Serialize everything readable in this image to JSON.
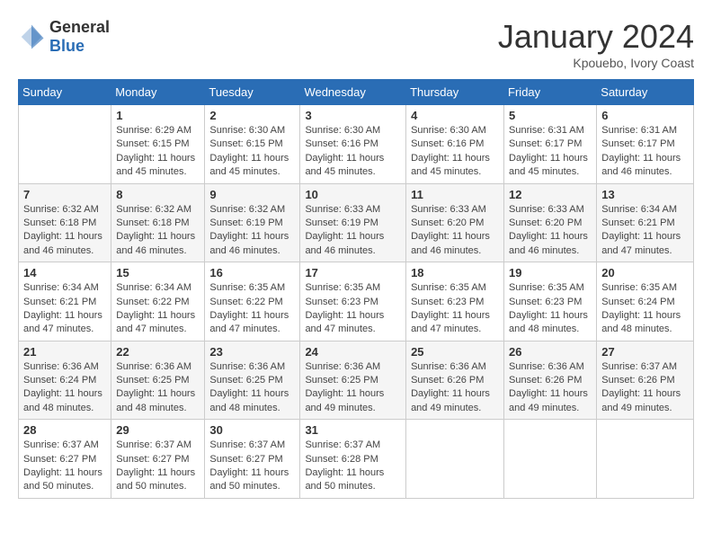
{
  "logo": {
    "general": "General",
    "blue": "Blue"
  },
  "title": "January 2024",
  "subtitle": "Kpouebo, Ivory Coast",
  "days": [
    "Sunday",
    "Monday",
    "Tuesday",
    "Wednesday",
    "Thursday",
    "Friday",
    "Saturday"
  ],
  "weeks": [
    [
      {
        "day": "",
        "content": ""
      },
      {
        "day": "1",
        "content": "Sunrise: 6:29 AM\nSunset: 6:15 PM\nDaylight: 11 hours and 45 minutes."
      },
      {
        "day": "2",
        "content": "Sunrise: 6:30 AM\nSunset: 6:15 PM\nDaylight: 11 hours and 45 minutes."
      },
      {
        "day": "3",
        "content": "Sunrise: 6:30 AM\nSunset: 6:16 PM\nDaylight: 11 hours and 45 minutes."
      },
      {
        "day": "4",
        "content": "Sunrise: 6:30 AM\nSunset: 6:16 PM\nDaylight: 11 hours and 45 minutes."
      },
      {
        "day": "5",
        "content": "Sunrise: 6:31 AM\nSunset: 6:17 PM\nDaylight: 11 hours and 45 minutes."
      },
      {
        "day": "6",
        "content": "Sunrise: 6:31 AM\nSunset: 6:17 PM\nDaylight: 11 hours and 46 minutes."
      }
    ],
    [
      {
        "day": "7",
        "content": "Sunrise: 6:32 AM\nSunset: 6:18 PM\nDaylight: 11 hours and 46 minutes."
      },
      {
        "day": "8",
        "content": "Sunrise: 6:32 AM\nSunset: 6:18 PM\nDaylight: 11 hours and 46 minutes."
      },
      {
        "day": "9",
        "content": "Sunrise: 6:32 AM\nSunset: 6:19 PM\nDaylight: 11 hours and 46 minutes."
      },
      {
        "day": "10",
        "content": "Sunrise: 6:33 AM\nSunset: 6:19 PM\nDaylight: 11 hours and 46 minutes."
      },
      {
        "day": "11",
        "content": "Sunrise: 6:33 AM\nSunset: 6:20 PM\nDaylight: 11 hours and 46 minutes."
      },
      {
        "day": "12",
        "content": "Sunrise: 6:33 AM\nSunset: 6:20 PM\nDaylight: 11 hours and 46 minutes."
      },
      {
        "day": "13",
        "content": "Sunrise: 6:34 AM\nSunset: 6:21 PM\nDaylight: 11 hours and 47 minutes."
      }
    ],
    [
      {
        "day": "14",
        "content": "Sunrise: 6:34 AM\nSunset: 6:21 PM\nDaylight: 11 hours and 47 minutes."
      },
      {
        "day": "15",
        "content": "Sunrise: 6:34 AM\nSunset: 6:22 PM\nDaylight: 11 hours and 47 minutes."
      },
      {
        "day": "16",
        "content": "Sunrise: 6:35 AM\nSunset: 6:22 PM\nDaylight: 11 hours and 47 minutes."
      },
      {
        "day": "17",
        "content": "Sunrise: 6:35 AM\nSunset: 6:23 PM\nDaylight: 11 hours and 47 minutes."
      },
      {
        "day": "18",
        "content": "Sunrise: 6:35 AM\nSunset: 6:23 PM\nDaylight: 11 hours and 47 minutes."
      },
      {
        "day": "19",
        "content": "Sunrise: 6:35 AM\nSunset: 6:23 PM\nDaylight: 11 hours and 48 minutes."
      },
      {
        "day": "20",
        "content": "Sunrise: 6:35 AM\nSunset: 6:24 PM\nDaylight: 11 hours and 48 minutes."
      }
    ],
    [
      {
        "day": "21",
        "content": "Sunrise: 6:36 AM\nSunset: 6:24 PM\nDaylight: 11 hours and 48 minutes."
      },
      {
        "day": "22",
        "content": "Sunrise: 6:36 AM\nSunset: 6:25 PM\nDaylight: 11 hours and 48 minutes."
      },
      {
        "day": "23",
        "content": "Sunrise: 6:36 AM\nSunset: 6:25 PM\nDaylight: 11 hours and 48 minutes."
      },
      {
        "day": "24",
        "content": "Sunrise: 6:36 AM\nSunset: 6:25 PM\nDaylight: 11 hours and 49 minutes."
      },
      {
        "day": "25",
        "content": "Sunrise: 6:36 AM\nSunset: 6:26 PM\nDaylight: 11 hours and 49 minutes."
      },
      {
        "day": "26",
        "content": "Sunrise: 6:36 AM\nSunset: 6:26 PM\nDaylight: 11 hours and 49 minutes."
      },
      {
        "day": "27",
        "content": "Sunrise: 6:37 AM\nSunset: 6:26 PM\nDaylight: 11 hours and 49 minutes."
      }
    ],
    [
      {
        "day": "28",
        "content": "Sunrise: 6:37 AM\nSunset: 6:27 PM\nDaylight: 11 hours and 50 minutes."
      },
      {
        "day": "29",
        "content": "Sunrise: 6:37 AM\nSunset: 6:27 PM\nDaylight: 11 hours and 50 minutes."
      },
      {
        "day": "30",
        "content": "Sunrise: 6:37 AM\nSunset: 6:27 PM\nDaylight: 11 hours and 50 minutes."
      },
      {
        "day": "31",
        "content": "Sunrise: 6:37 AM\nSunset: 6:28 PM\nDaylight: 11 hours and 50 minutes."
      },
      {
        "day": "",
        "content": ""
      },
      {
        "day": "",
        "content": ""
      },
      {
        "day": "",
        "content": ""
      }
    ]
  ]
}
